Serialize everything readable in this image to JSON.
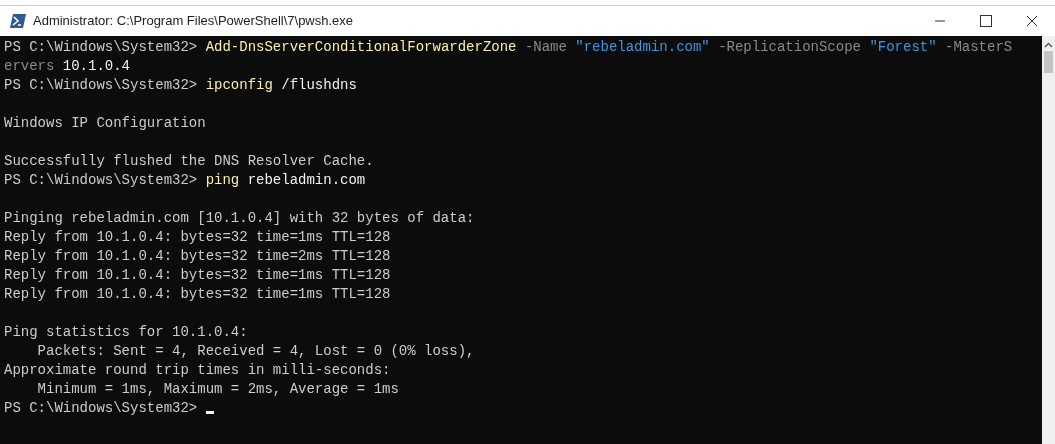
{
  "window": {
    "title": "Administrator: C:\\Program Files\\PowerShell\\7\\pwsh.exe"
  },
  "console": {
    "lines": [
      {
        "kind": "text",
        "segments": [
          {
            "kind": "output",
            "text": "PS C:\\Windows\\System32> "
          },
          {
            "kind": "command",
            "text": "Add-DnsServerConditionalForwarderZone"
          },
          {
            "kind": "parameter",
            "text": " -Name "
          },
          {
            "kind": "string",
            "text": "\"rebeladmin.com\""
          },
          {
            "kind": "parameter",
            "text": " -ReplicationScope "
          },
          {
            "kind": "string",
            "text": "\"Forest\""
          },
          {
            "kind": "parameter",
            "text": " -MasterS"
          }
        ]
      },
      {
        "kind": "text",
        "segments": [
          {
            "kind": "parameter",
            "text": "ervers "
          },
          {
            "kind": "value",
            "text": "10.1.0.4"
          }
        ]
      },
      {
        "kind": "text",
        "segments": [
          {
            "kind": "output",
            "text": "PS C:\\Windows\\System32> "
          },
          {
            "kind": "command",
            "text": "ipconfig"
          },
          {
            "kind": "value",
            "text": " /flushdns"
          }
        ]
      },
      {
        "kind": "blank"
      },
      {
        "kind": "text",
        "segments": [
          {
            "kind": "output",
            "text": "Windows IP Configuration"
          }
        ]
      },
      {
        "kind": "blank"
      },
      {
        "kind": "text",
        "segments": [
          {
            "kind": "output",
            "text": "Successfully flushed the DNS Resolver Cache."
          }
        ]
      },
      {
        "kind": "text",
        "segments": [
          {
            "kind": "output",
            "text": "PS C:\\Windows\\System32> "
          },
          {
            "kind": "command",
            "text": "ping"
          },
          {
            "kind": "value",
            "text": " rebeladmin.com"
          }
        ]
      },
      {
        "kind": "blank"
      },
      {
        "kind": "text",
        "segments": [
          {
            "kind": "output",
            "text": "Pinging rebeladmin.com [10.1.0.4] with 32 bytes of data:"
          }
        ]
      },
      {
        "kind": "text",
        "segments": [
          {
            "kind": "output",
            "text": "Reply from 10.1.0.4: bytes=32 time=1ms TTL=128"
          }
        ]
      },
      {
        "kind": "text",
        "segments": [
          {
            "kind": "output",
            "text": "Reply from 10.1.0.4: bytes=32 time=2ms TTL=128"
          }
        ]
      },
      {
        "kind": "text",
        "segments": [
          {
            "kind": "output",
            "text": "Reply from 10.1.0.4: bytes=32 time=1ms TTL=128"
          }
        ]
      },
      {
        "kind": "text",
        "segments": [
          {
            "kind": "output",
            "text": "Reply from 10.1.0.4: bytes=32 time=1ms TTL=128"
          }
        ]
      },
      {
        "kind": "blank"
      },
      {
        "kind": "text",
        "segments": [
          {
            "kind": "output",
            "text": "Ping statistics for 10.1.0.4:"
          }
        ]
      },
      {
        "kind": "text",
        "segments": [
          {
            "kind": "output",
            "text": "    Packets: Sent = 4, Received = 4, Lost = 0 (0% loss),"
          }
        ]
      },
      {
        "kind": "text",
        "segments": [
          {
            "kind": "output",
            "text": "Approximate round trip times in milli-seconds:"
          }
        ]
      },
      {
        "kind": "text",
        "segments": [
          {
            "kind": "output",
            "text": "    Minimum = 1ms, Maximum = 2ms, Average = 1ms"
          }
        ]
      },
      {
        "kind": "prompt",
        "segments": [
          {
            "kind": "output",
            "text": "PS C:\\Windows\\System32> "
          }
        ]
      }
    ]
  }
}
